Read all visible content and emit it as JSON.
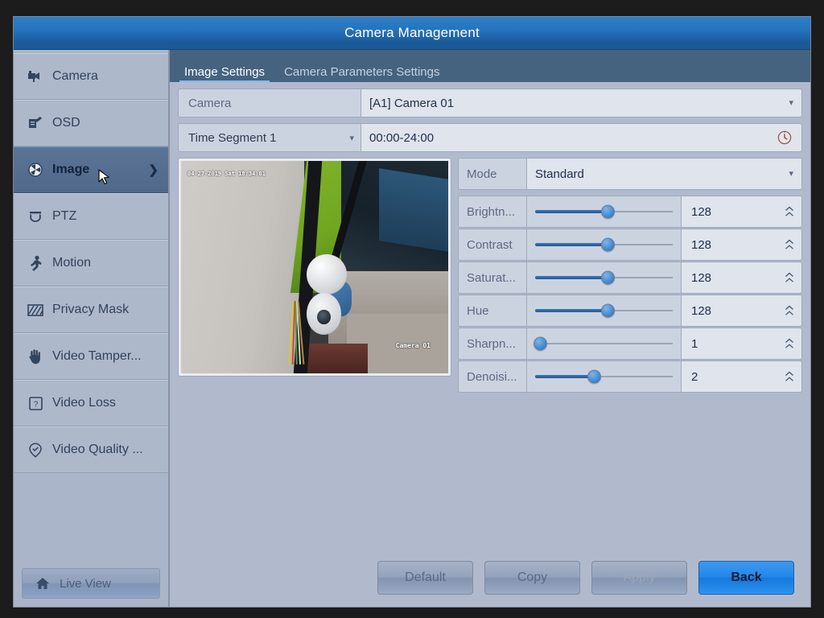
{
  "window": {
    "title": "Camera Management"
  },
  "sidebar": {
    "items": [
      {
        "label": "Camera",
        "icon": "camera-icon",
        "selected": false
      },
      {
        "label": "OSD",
        "icon": "osd-pen-icon",
        "selected": false
      },
      {
        "label": "Image",
        "icon": "image-icon",
        "selected": true,
        "chevron": "❯"
      },
      {
        "label": "PTZ",
        "icon": "ptz-icon",
        "selected": false
      },
      {
        "label": "Motion",
        "icon": "motion-person-icon",
        "selected": false
      },
      {
        "label": "Privacy Mask",
        "icon": "privacy-mask-icon",
        "selected": false
      },
      {
        "label": "Video Tamper...",
        "icon": "hand-icon",
        "selected": false
      },
      {
        "label": "Video Loss",
        "icon": "question-box-icon",
        "selected": false
      },
      {
        "label": "Video Quality ...",
        "icon": "check-badge-icon",
        "selected": false
      }
    ],
    "live_view": {
      "label": "Live View",
      "icon": "home-icon"
    }
  },
  "tabs": [
    {
      "label": "Image Settings",
      "active": true
    },
    {
      "label": "Camera Parameters Settings",
      "active": false
    }
  ],
  "fields": {
    "camera": {
      "label": "Camera",
      "value": "[A1] Camera 01"
    },
    "time_segment": {
      "label": "Time Segment 1",
      "value": "00:00-24:00",
      "clock_icon": "clock-icon"
    }
  },
  "preview": {
    "timestamp": "04-27-2019 Sat 18:34:01",
    "camera_label": "Camera 01"
  },
  "settings": {
    "mode": {
      "label": "Mode",
      "value": "Standard"
    },
    "sliders": [
      {
        "label": "Brightn...",
        "value": "128",
        "percent": 52
      },
      {
        "label": "Contrast",
        "value": "128",
        "percent": 52
      },
      {
        "label": "Saturat...",
        "value": "128",
        "percent": 52
      },
      {
        "label": "Hue",
        "value": "128",
        "percent": 52
      },
      {
        "label": "Sharpn...",
        "value": "1",
        "percent": 3
      },
      {
        "label": "Denoisi...",
        "value": "2",
        "percent": 42
      }
    ]
  },
  "footer": {
    "default_label": "Default",
    "copy_label": "Copy",
    "apply_label": "Apply",
    "back_label": "Back"
  },
  "colors": {
    "titlebar": "#2574bd",
    "accent": "#2186e8",
    "panel": "#b1bacd",
    "sidebar": "#aeb8cb",
    "tabbar": "#45637f",
    "selected_nav": "#50688a"
  }
}
